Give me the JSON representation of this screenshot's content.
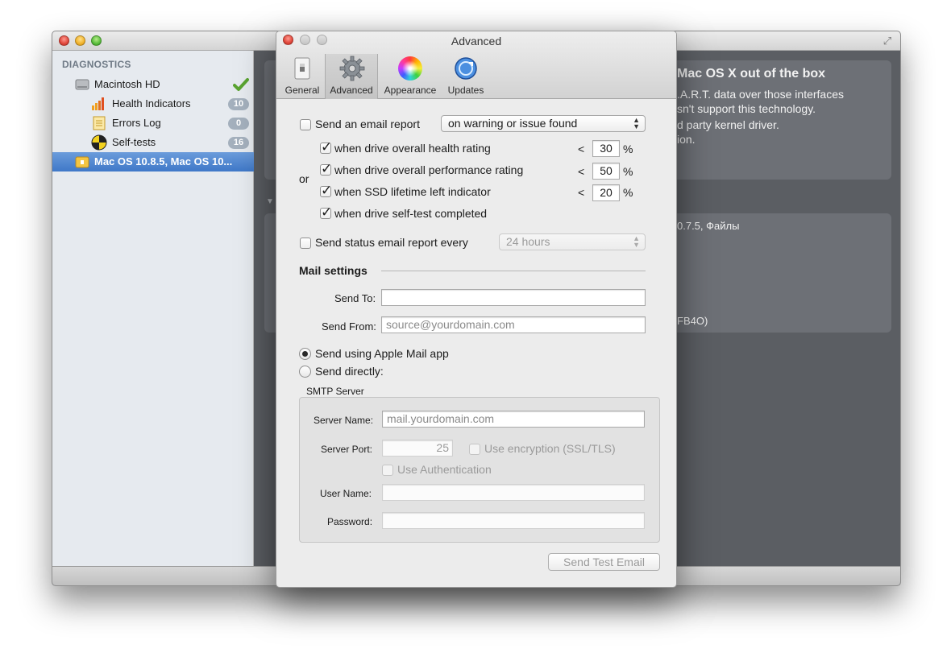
{
  "back_window": {
    "sidebar": {
      "heading": "DIAGNOSTICS",
      "items": [
        {
          "label": "Macintosh HD",
          "badge": "",
          "status": "ok"
        },
        {
          "label": "Health Indicators",
          "badge": "10"
        },
        {
          "label": "Errors Log",
          "badge": "0"
        },
        {
          "label": "Self-tests",
          "badge": "16"
        },
        {
          "label": "Mac OS 10.8.5, Mac OS 10...",
          "badge": ""
        }
      ]
    },
    "content": {
      "card_title": "Mac OS X out of the box",
      "card_lines": [
        ".A.R.T. data over those interfaces",
        "sn't support this technology.",
        "d party kernel driver.",
        "ion."
      ],
      "info_line_1": "0.7.5, Файлы",
      "info_line_2": "FB4O)"
    }
  },
  "prefs": {
    "title": "Advanced",
    "toolbar": [
      {
        "label": "General",
        "icon": "switch-icon"
      },
      {
        "label": "Advanced",
        "icon": "gear-icon"
      },
      {
        "label": "Appearance",
        "icon": "color-wheel-icon"
      },
      {
        "label": "Updates",
        "icon": "globe-update-icon"
      }
    ],
    "email_report": {
      "label": "Send an email report",
      "mode": "on warning or issue found",
      "or_label": "or",
      "conditions": [
        {
          "label": "when drive overall health rating",
          "op": "<",
          "value": "30",
          "unit": "%"
        },
        {
          "label": "when drive overall performance rating",
          "op": "<",
          "value": "50",
          "unit": "%"
        },
        {
          "label": "when SSD lifetime left indicator",
          "op": "<",
          "value": "20",
          "unit": "%"
        },
        {
          "label": "when drive self-test completed"
        }
      ]
    },
    "status_report": {
      "label": "Send status email report every",
      "interval": "24 hours"
    },
    "mail_settings": {
      "heading": "Mail settings",
      "send_to_label": "Send To:",
      "send_to_value": "",
      "send_from_label": "Send From:",
      "send_from_placeholder": "source@yourdomain.com",
      "radio_apple_mail": "Send using Apple Mail app",
      "radio_direct": "Send directly:"
    },
    "smtp": {
      "heading": "SMTP Server",
      "server_name_label": "Server Name:",
      "server_name_placeholder": "mail.yourdomain.com",
      "server_port_label": "Server Port:",
      "server_port_value": "25",
      "encryption_label": "Use encryption (SSL/TLS)",
      "auth_label": "Use Authentication",
      "user_name_label": "User Name:",
      "password_label": "Password:"
    },
    "send_test_button": "Send Test Email"
  }
}
